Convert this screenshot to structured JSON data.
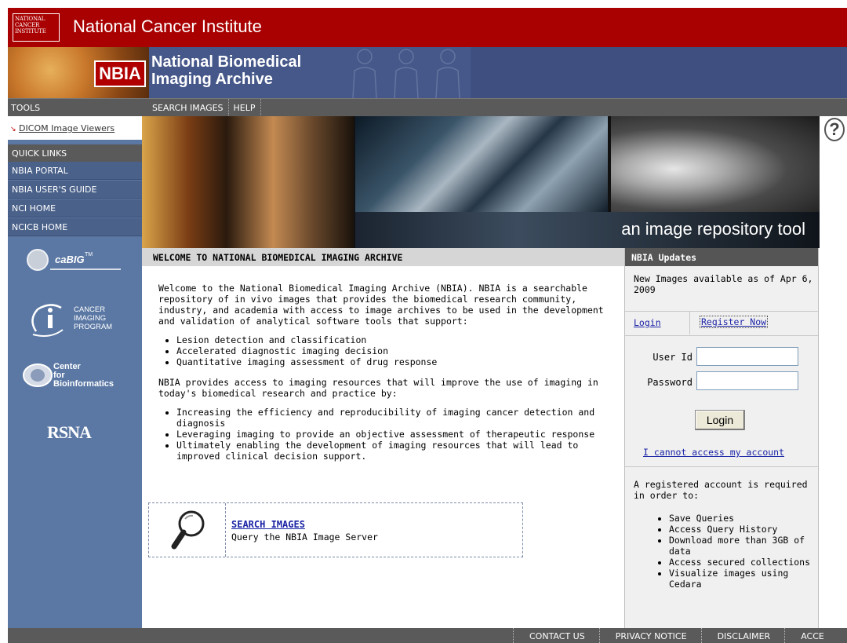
{
  "header": {
    "nci_logo_text": "NATIONAL CANCER INSTITUTE",
    "nci_title": "National Cancer Institute",
    "nbia_badge": "NBIA",
    "nbia_title_line1": "National Biomedical",
    "nbia_title_line2": "Imaging Archive"
  },
  "nav": {
    "tools_label": "TOOLS",
    "links": [
      "SEARCH IMAGES",
      "HELP"
    ]
  },
  "sidebar": {
    "dicom_link": "DICOM Image Viewers",
    "quick_links_label": "QUICK LINKS",
    "quick_links": [
      "NBIA PORTAL",
      "NBIA USER'S GUIDE",
      "NCI HOME",
      "NCICB HOME"
    ],
    "logos": {
      "cabig": "caBIG",
      "cabig_tm": "TM",
      "cip_line1": "CANCER",
      "cip_line2": "IMAGING",
      "cip_line3": "PROGRAM",
      "center_line1": "Center",
      "center_line2": "for",
      "center_line3": "Bioinformatics",
      "rsna": "RSNA"
    }
  },
  "hero": {
    "tagline": "an image repository tool",
    "help_icon": "?"
  },
  "welcome": {
    "heading": "WELCOME TO NATIONAL BIOMEDICAL IMAGING ARCHIVE",
    "intro": "Welcome to the National Biomedical Imaging Archive (NBIA). NBIA is a searchable repository of in vivo images that provides the biomedical research community, industry, and academia with access to image archives to be used in the development and validation of analytical software tools that support:",
    "support_list": [
      "Lesion detection and classification",
      "Accelerated diagnostic imaging decision",
      "Quantitative imaging assessment of drug response"
    ],
    "access_intro": "NBIA provides access to imaging resources that will improve the use of imaging in today's biomedical research and practice by:",
    "access_list": [
      "Increasing the efficiency and reproducibility of imaging cancer detection and diagnosis",
      "Leveraging imaging to provide an objective assessment of therapeutic response",
      "Ultimately enabling the development of imaging resources that will lead to improved clinical decision support."
    ],
    "search_link": "SEARCH IMAGES",
    "search_desc": "Query the NBIA Image Server"
  },
  "updates": {
    "heading": "NBIA Updates",
    "news": "New Images available as of Apr 6, 2009",
    "tab_login": "Login",
    "tab_register": "Register Now",
    "user_id_label": "User Id",
    "password_label": "Password",
    "user_id_value": "",
    "password_value": "",
    "login_button": "Login",
    "cannot_access": "I cannot access my account",
    "required_text": "A registered account is required in order to:",
    "required_list": [
      "Save Queries",
      "Access Query History",
      "Download more than 3GB of data",
      "Access secured collections",
      "Visualize images using Cedara"
    ]
  },
  "footer": {
    "links": [
      "CONTACT US",
      "PRIVACY NOTICE",
      "DISCLAIMER",
      "ACCE"
    ]
  },
  "colors": {
    "nci_red": "#a90101",
    "banner_blue": "#46588a",
    "sidebar_blue": "#5b78a4",
    "link_blue": "#1a23a6",
    "gray_bar": "#5a5a5a"
  }
}
